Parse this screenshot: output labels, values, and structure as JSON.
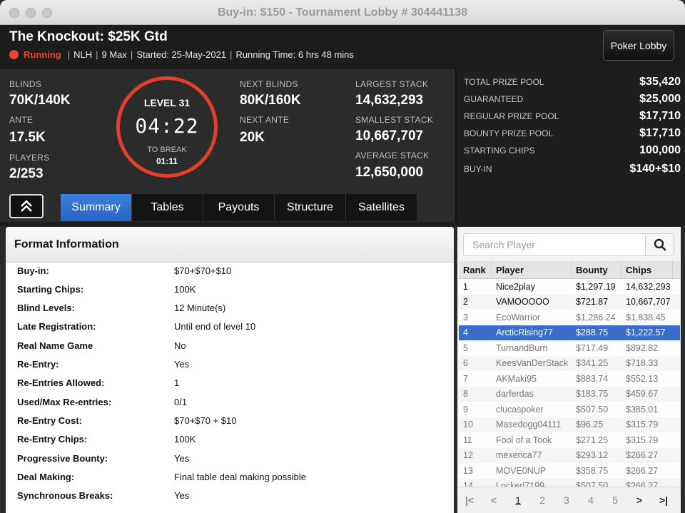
{
  "window": {
    "title": "Buy-in: $150 - Tournament Lobby # 304441138"
  },
  "header": {
    "tournament_name": "The Knockout: $25K Gtd",
    "status": "Running",
    "game": "NLH",
    "max": "9 Max",
    "started": "Started: 25-May-2021",
    "running_time": "Running Time: 6 hrs 48 mins",
    "lobby_button": "Poker Lobby",
    "status_color": "#e8472e"
  },
  "stats": {
    "blinds_label": "BLINDS",
    "blinds": "70K/140K",
    "ante_label": "ANTE",
    "ante": "17.5K",
    "players_label": "PLAYERS",
    "players": "2/253",
    "level": "LEVEL 31",
    "clock": "04:22",
    "to_break_label": "TO BREAK",
    "to_break": "01:11",
    "next_blinds_label": "NEXT BLINDS",
    "next_blinds": "80K/160K",
    "next_ante_label": "NEXT ANTE",
    "next_ante": "20K",
    "largest_label": "LARGEST STACK",
    "largest": "14,632,293",
    "smallest_label": "SMALLEST STACK",
    "smallest": "10,667,707",
    "average_label": "AVERAGE STACK",
    "average": "12,650,000"
  },
  "prize": [
    {
      "label": "TOTAL PRIZE POOL",
      "value": "$35,420"
    },
    {
      "label": "GUARANTEED",
      "value": "$25,000"
    },
    {
      "label": "REGULAR PRIZE POOL",
      "value": "$17,710"
    },
    {
      "label": "BOUNTY PRIZE POOL",
      "value": "$17,710"
    },
    {
      "label": "STARTING CHIPS",
      "value": "100,000"
    },
    {
      "label": "BUY-IN",
      "value": "$140+$10"
    }
  ],
  "tabs": [
    "Summary",
    "Tables",
    "Payouts",
    "Structure",
    "Satellites"
  ],
  "active_tab": "Summary",
  "format": {
    "title": "Format Information",
    "rows": [
      {
        "label": "Buy-in:",
        "value": "$70+$70+$10"
      },
      {
        "label": "Starting Chips:",
        "value": "100K"
      },
      {
        "label": "Blind Levels:",
        "value": "12 Minute(s)"
      },
      {
        "label": "Late Registration:",
        "value": "Until end of level 10"
      },
      {
        "label": "Real Name Game",
        "value": "No"
      },
      {
        "label": "Re-Entry:",
        "value": "Yes"
      },
      {
        "label": "Re-Entries Allowed:",
        "value": "1"
      },
      {
        "label": "Used/Max Re-entries:",
        "value": "0/1"
      },
      {
        "label": "Re-Entry Cost:",
        "value": "$70+$70 + $10"
      },
      {
        "label": "Re-Entry Chips:",
        "value": "100K"
      },
      {
        "label": "Progressive Bounty:",
        "value": "Yes"
      },
      {
        "label": "Deal Making:",
        "value": "Final table deal making possible"
      },
      {
        "label": "Synchronous Breaks:",
        "value": "Yes"
      }
    ]
  },
  "players_panel": {
    "search_placeholder": "Search Player",
    "columns": [
      "Rank",
      "Player",
      "Bounty",
      "Chips"
    ],
    "rows": [
      [
        "1",
        "Nice2play",
        "$1,297.19",
        "14,632,293"
      ],
      [
        "2",
        "VAMOOOOO",
        "$721.87",
        "10,667,707"
      ],
      [
        "3",
        "EcoWarrior",
        "$1,286.24",
        "$1,838.45"
      ],
      [
        "4",
        "ArcticRising77",
        "$288.75",
        "$1,222.57"
      ],
      [
        "5",
        "TurnandBurn",
        "$717.49",
        "$892.82"
      ],
      [
        "6",
        "KeesVanDerStack",
        "$341.25",
        "$718.33"
      ],
      [
        "7",
        "AKMaki95",
        "$883.74",
        "$552.13"
      ],
      [
        "8",
        "darferdas",
        "$183.75",
        "$459.67"
      ],
      [
        "9",
        "clucaspoker",
        "$507.50",
        "$385.01"
      ],
      [
        "10",
        "Masedogg04111",
        "$96.25",
        "$315.79"
      ],
      [
        "11",
        "Fool of a Took",
        "$271.25",
        "$315.79"
      ],
      [
        "12",
        "mexerica77",
        "$293.12",
        "$266.27"
      ],
      [
        "13",
        "MOVE0NUP",
        "$358.75",
        "$266.27"
      ],
      [
        "14",
        "Lockerl7199",
        "$507.50",
        "$266.27"
      ]
    ],
    "selected_rank": "4",
    "pages": [
      "1",
      "2",
      "3",
      "4",
      "5"
    ],
    "current_page": "1"
  }
}
